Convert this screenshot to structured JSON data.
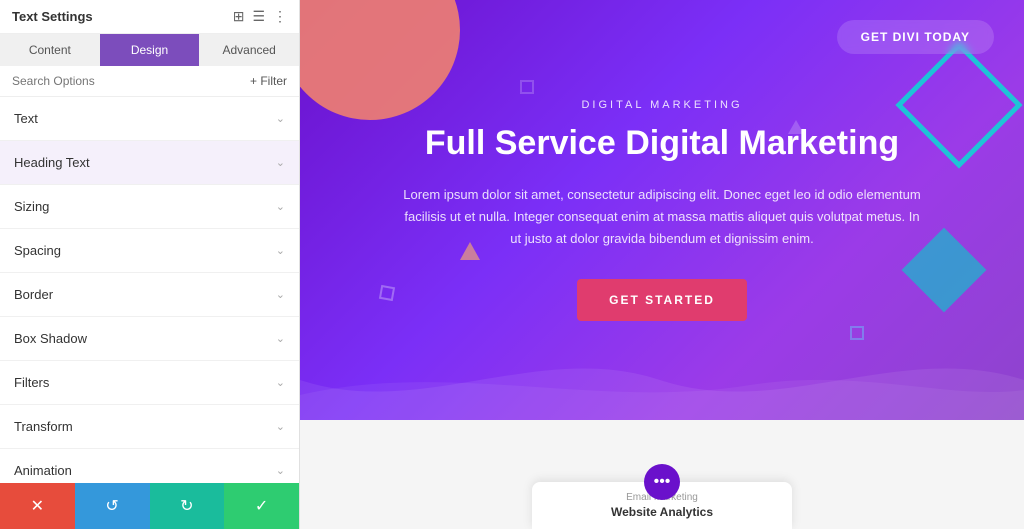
{
  "panel": {
    "title": "Text Settings",
    "icons": [
      "⊞",
      "⊟",
      "⋮"
    ],
    "tabs": [
      {
        "id": "content",
        "label": "Content",
        "active": false
      },
      {
        "id": "design",
        "label": "Design",
        "active": true
      },
      {
        "id": "advanced",
        "label": "Advanced",
        "active": false
      }
    ],
    "search_placeholder": "Search Options",
    "filter_label": "+ Filter",
    "accordion": [
      {
        "id": "text",
        "label": "Text",
        "open": false
      },
      {
        "id": "heading",
        "label": "Heading Text",
        "open": false,
        "active": true
      },
      {
        "id": "sizing",
        "label": "Sizing",
        "open": false
      },
      {
        "id": "spacing",
        "label": "Spacing",
        "open": false
      },
      {
        "id": "border",
        "label": "Border",
        "open": false
      },
      {
        "id": "box-shadow",
        "label": "Box Shadow",
        "open": false
      },
      {
        "id": "filters",
        "label": "Filters",
        "open": false
      },
      {
        "id": "transform",
        "label": "Transform",
        "open": false
      },
      {
        "id": "animation",
        "label": "Animation",
        "open": false
      }
    ],
    "bottom_bar": [
      {
        "id": "cancel",
        "icon": "✕",
        "color": "#e74c3c"
      },
      {
        "id": "undo",
        "icon": "↺",
        "color": "#3498db"
      },
      {
        "id": "redo",
        "icon": "↻",
        "color": "#1abc9c"
      },
      {
        "id": "save",
        "icon": "✓",
        "color": "#2ecc71"
      }
    ]
  },
  "hero": {
    "get_divi_label": "GET DIVI TODAY",
    "subtitle": "DIGITAL MARKETING",
    "title": "Full Service Digital Marketing",
    "body": "Lorem ipsum dolor sit amet, consectetur adipiscing elit. Donec eget leo id odio elementum facilisis ut et nulla. Integer consequat enim at massa mattis aliquet quis volutpat metus. In ut justo at dolor gravida bibendum et dignissim enim.",
    "cta_label": "GET STARTED"
  },
  "analytics": {
    "small_label": "Email Marketing",
    "title": "Website Analytics",
    "dots": "•••"
  }
}
